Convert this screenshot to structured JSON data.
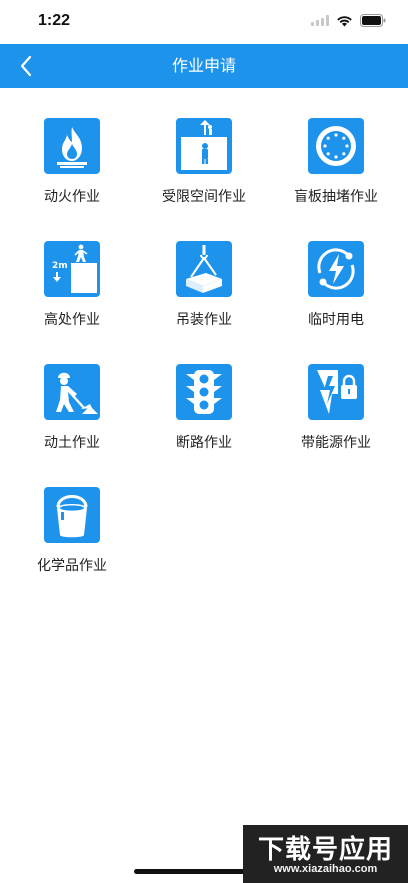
{
  "status_bar": {
    "time": "1:22"
  },
  "nav": {
    "title": "作业申请",
    "back_icon": "chevron-left-icon"
  },
  "colors": {
    "accent": "#1e93ec",
    "background": "#ffffff",
    "label": "#222222"
  },
  "tiles": [
    {
      "label": "动火作业",
      "icon": "fire-icon"
    },
    {
      "label": "受限空间作业",
      "icon": "confined-space-icon"
    },
    {
      "label": "盲板抽堵作业",
      "icon": "blind-plate-icon"
    },
    {
      "label": "高处作业",
      "icon": "height-work-icon"
    },
    {
      "label": "吊装作业",
      "icon": "lifting-icon"
    },
    {
      "label": "临时用电",
      "icon": "temporary-power-icon"
    },
    {
      "label": "动土作业",
      "icon": "excavation-icon"
    },
    {
      "label": "断路作业",
      "icon": "road-closure-icon"
    },
    {
      "label": "带能源作业",
      "icon": "energized-work-icon"
    },
    {
      "label": "化学品作业",
      "icon": "chemical-icon"
    }
  ],
  "height_icon_text": "2m",
  "watermark": {
    "title": "下载号应用",
    "url": "www.xiazaihao.com"
  }
}
